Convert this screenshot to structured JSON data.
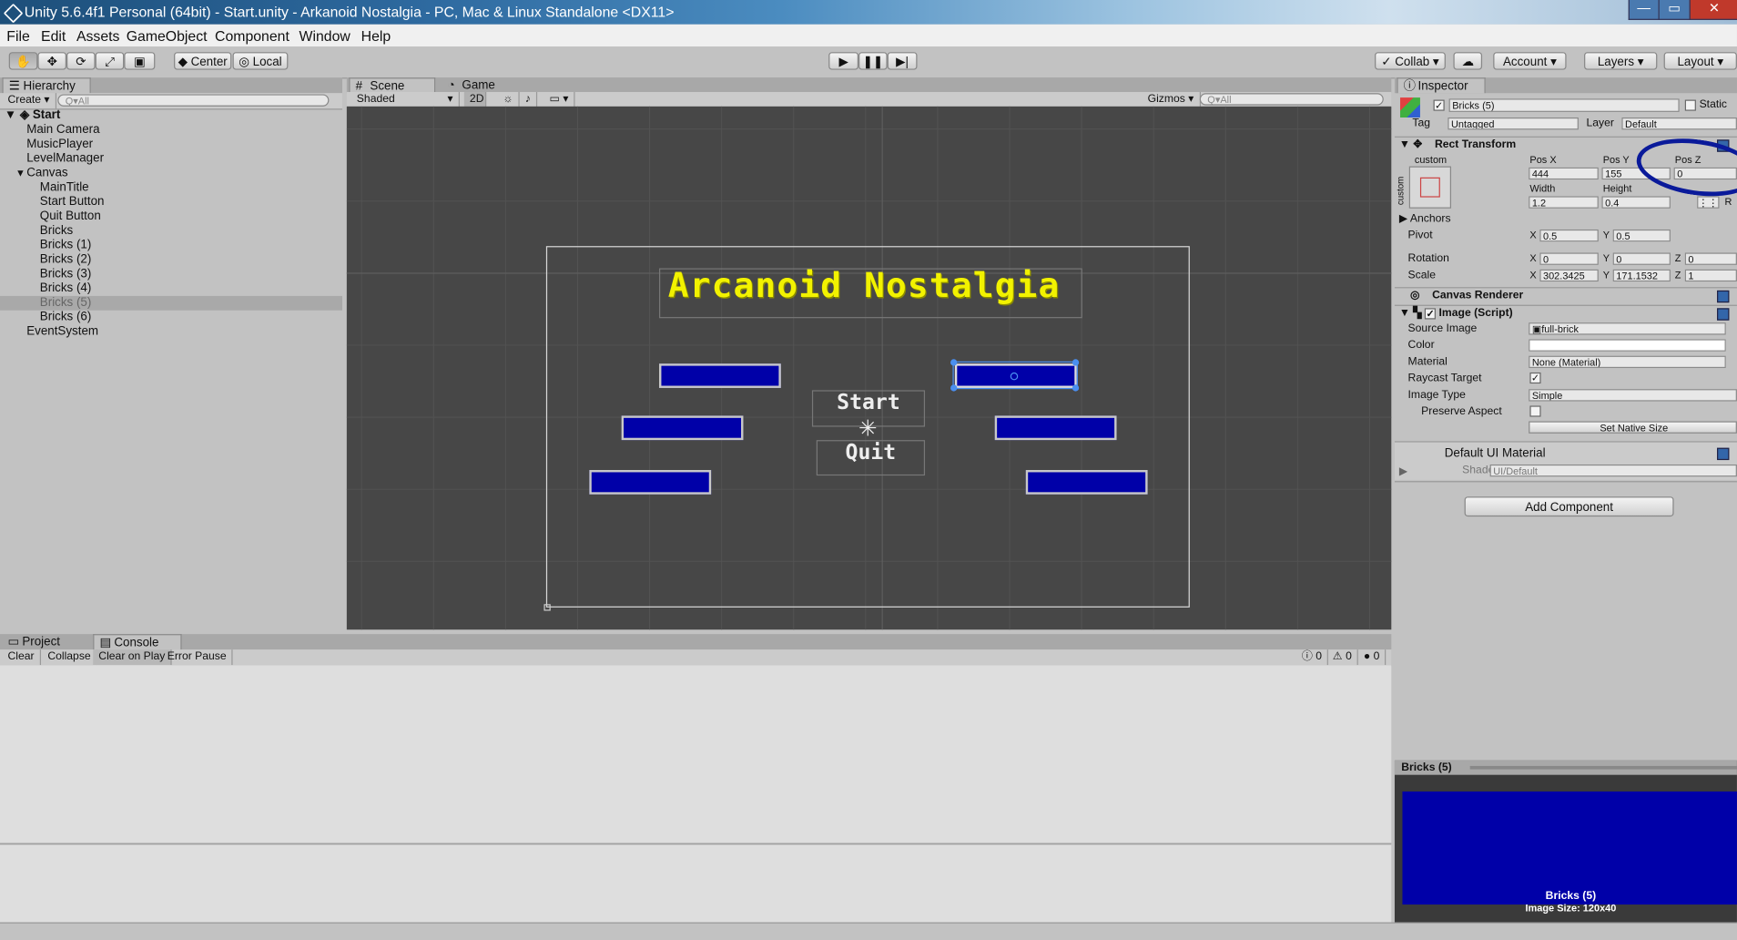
{
  "window": {
    "title": "Unity 5.6.4f1 Personal (64bit) - Start.unity - Arkanoid Nostalgia - PC, Mac & Linux Standalone <DX11>",
    "controls": [
      "—",
      "▭",
      "✕"
    ]
  },
  "menu": [
    "File",
    "Edit",
    "Assets",
    "GameObject",
    "Component",
    "Window",
    "Help"
  ],
  "toolbar": {
    "pivot": "Center",
    "space": "Local",
    "collab": "Collab ▾",
    "account": "Account",
    "layers": "Layers",
    "layout": "Layout"
  },
  "hierarchy": {
    "tab": "Hierarchy",
    "create": "Create ▾",
    "search_placeholder": "Q▾All",
    "scene": "Start",
    "items": [
      {
        "label": "Main Camera",
        "depth": 1
      },
      {
        "label": "MusicPlayer",
        "depth": 1
      },
      {
        "label": "LevelManager",
        "depth": 1
      },
      {
        "label": "Canvas",
        "depth": 1
      },
      {
        "label": "MainTitle",
        "depth": 2
      },
      {
        "label": "Start Button",
        "depth": 2
      },
      {
        "label": "Quit Button",
        "depth": 2
      },
      {
        "label": "Bricks",
        "depth": 2
      },
      {
        "label": "Bricks (1)",
        "depth": 2
      },
      {
        "label": "Bricks (2)",
        "depth": 2
      },
      {
        "label": "Bricks (3)",
        "depth": 2
      },
      {
        "label": "Bricks (4)",
        "depth": 2
      },
      {
        "label": "Bricks (5)",
        "depth": 2,
        "selected": true
      },
      {
        "label": "Bricks (6)",
        "depth": 2
      },
      {
        "label": "EventSystem",
        "depth": 1
      }
    ]
  },
  "scene": {
    "tabs": [
      "Scene",
      "Game"
    ],
    "shading": "Shaded",
    "mode2d": "2D",
    "gizmos": "Gizmos ▾",
    "search_placeholder": "Q▾All",
    "game_title": "Arcanoid Nostalgia",
    "start_label": "Start",
    "quit_label": "Quit",
    "brick_color": "#0000a8",
    "title_color": "#f2f200"
  },
  "console": {
    "tabs": [
      "Project",
      "Console"
    ],
    "buttons": [
      "Clear",
      "Collapse",
      "Clear on Play",
      "Error Pause"
    ],
    "counts": [
      "0",
      "0",
      "0"
    ]
  },
  "inspector": {
    "tab": "Inspector",
    "object_name": "Bricks (5)",
    "static_label": "Static",
    "tag_label": "Tag",
    "tag_value": "Untagged",
    "layer_label": "Layer",
    "layer_value": "Default",
    "rect_transform": {
      "title": "Rect Transform",
      "anchor_preset": "custom",
      "side_label": "custom",
      "pos_x_label": "Pos X",
      "pos_x": "444",
      "pos_y_label": "Pos Y",
      "pos_y": "155",
      "pos_z_label": "Pos Z",
      "pos_z": "0",
      "width_label": "Width",
      "width": "1.2",
      "height_label": "Height",
      "height": "0.4",
      "anchors_label": "Anchors",
      "pivot_label": "Pivot",
      "pivot_x": "0.5",
      "pivot_y": "0.5",
      "rotation_label": "Rotation",
      "rot_x": "0",
      "rot_y": "0",
      "rot_z": "0",
      "scale_label": "Scale",
      "scale_x": "302.3425",
      "scale_y": "171.1532",
      "scale_z": "1",
      "axis_x": "X",
      "axis_y": "Y",
      "axis_z": "Z",
      "raw_button": "R"
    },
    "canvas_renderer": "Canvas Renderer",
    "image_script": {
      "title": "Image (Script)",
      "source_image_label": "Source Image",
      "source_image": "full-brick",
      "color_label": "Color",
      "material_label": "Material",
      "material": "None (Material)",
      "raycast_label": "Raycast Target",
      "image_type_label": "Image Type",
      "image_type": "Simple",
      "preserve_label": "Preserve Aspect",
      "native_size": "Set Native Size"
    },
    "material": {
      "title": "Default UI Material",
      "shader_label": "Shader",
      "shader": "UI/Default"
    },
    "add_component": "Add Component",
    "preview_title": "Bricks (5)",
    "preview_name": "Bricks (5)",
    "preview_size": "Image Size: 120x40",
    "annotation_color": "#0a1a9a"
  }
}
